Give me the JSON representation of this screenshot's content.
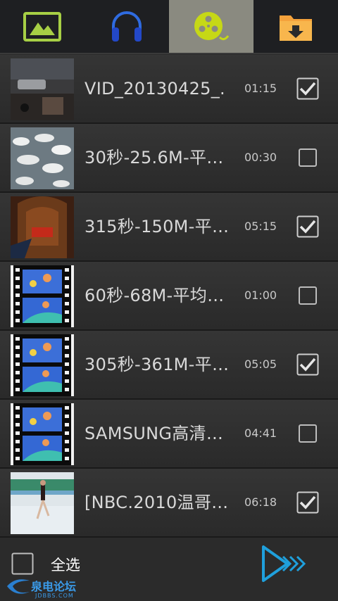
{
  "tabs": [
    {
      "icon": "image-icon",
      "active": false
    },
    {
      "icon": "headphones-icon",
      "active": false
    },
    {
      "icon": "film-reel-icon",
      "active": true
    },
    {
      "icon": "folder-download-icon",
      "active": false
    }
  ],
  "videos": [
    {
      "title": "VID_20130425_.",
      "duration": "01:15",
      "checked": true,
      "thumb": "night-street"
    },
    {
      "title": "30秒-25.6M-平…",
      "duration": "00:30",
      "checked": false,
      "thumb": "gannets"
    },
    {
      "title": "315秒-150M-平…",
      "duration": "05:15",
      "checked": true,
      "thumb": "theater"
    },
    {
      "title": "60秒-68M-平均…",
      "duration": "01:00",
      "checked": false,
      "thumb": "film-strip"
    },
    {
      "title": "305秒-361M-平…",
      "duration": "05:05",
      "checked": true,
      "thumb": "film-strip"
    },
    {
      "title": "SAMSUNG高清…",
      "duration": "04:41",
      "checked": false,
      "thumb": "film-strip"
    },
    {
      "title": "[NBC.2010温哥…",
      "duration": "06:18",
      "checked": true,
      "thumb": "skater"
    }
  ],
  "footer": {
    "select_all_label": "全选",
    "select_all_checked": false,
    "watermark_cn": "泉电论坛",
    "watermark_url": "JDBBS.COM"
  }
}
